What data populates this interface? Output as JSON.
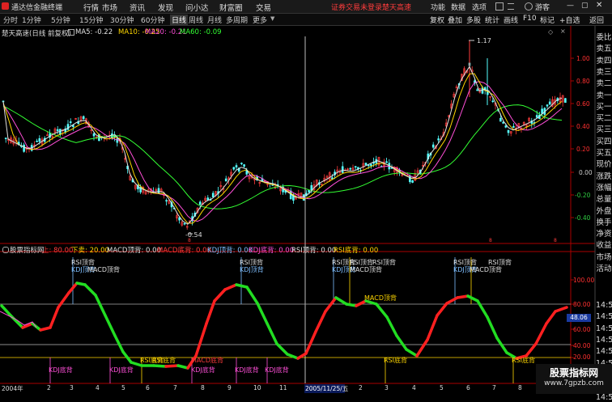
{
  "app": {
    "title": "通达信金融终端"
  },
  "menu": [
    "行情",
    "市场",
    "资讯",
    "发现",
    "问小达",
    "财富圈",
    "交易"
  ],
  "top_right": {
    "warning": "证券交易未登录",
    "brand": "楚天高速",
    "items": [
      "功能",
      "数据",
      "选项"
    ],
    "user": "游客"
  },
  "periods": [
    "分时",
    "1分钟",
    "5分钟",
    "15分钟",
    "30分钟",
    "60分钟",
    "日线",
    "周线",
    "月线",
    "多周期",
    "更多"
  ],
  "active_period": "日线",
  "toolbar": [
    "复权",
    "叠加",
    "多股",
    "统计",
    "画线",
    "F10",
    "标记",
    "+自选",
    "返回"
  ],
  "main_chart": {
    "title": "楚天高速(日线 前复权)",
    "ma": [
      {
        "label": "MA5: -0.22",
        "color": "#e0e0e0"
      },
      {
        "label": "MA10: -0.25",
        "color": "#ffd700"
      },
      {
        "label": "MA20: -0.21",
        "color": "#ff4fd8"
      },
      {
        "label": "MA60: -0.09",
        "color": "#33ff33"
      }
    ],
    "y_labels": [
      "1.00",
      "0.80",
      "0.60",
      "0.40",
      "0.20",
      "0.00",
      "-0.20",
      "-0.40"
    ],
    "annotations": {
      "high": "1.17",
      "low": "-0.54"
    }
  },
  "indicator": {
    "title": "股票指标网",
    "values": [
      {
        "label": "上: 80.00",
        "color": "#ff3c3c"
      },
      {
        "label": "下卖: 20.00",
        "color": "#ffd700"
      },
      {
        "label": "MACD顶背: 0.00",
        "color": "#e0e0e0"
      },
      {
        "label": "MACD底背: 0.00",
        "color": "#ff3c3c"
      },
      {
        "label": "KDJ顶背: 0.00",
        "color": "#7fbfff"
      },
      {
        "label": "KDJ底背: 0.00",
        "color": "#ff4fd8"
      },
      {
        "label": "RSI顶背: 0.00",
        "color": "#e0e0e0"
      },
      {
        "label": "RSI底背: 0.00",
        "color": "#ffd700"
      }
    ],
    "y_labels": [
      "100.00",
      "80.00",
      "60.00",
      "40.00",
      "20.00"
    ],
    "current_value": "48.06",
    "signals": {
      "rsi_top": "RSI顶背",
      "kdj_top": "KDJ顶背",
      "macd_top": "MACD顶背",
      "kdj_bottom": "KDJ底背",
      "rsi_bottom": "RSI底背",
      "macd_bottom": "MACD底背"
    }
  },
  "x_axis": {
    "year": "2004年",
    "labels": [
      "2",
      "3",
      "4",
      "5",
      "6",
      "7",
      "8",
      "9",
      "10",
      "11",
      "2",
      "3",
      "4",
      "5",
      "6",
      "7",
      "8"
    ],
    "cursor_date": "2005/11/25/五"
  },
  "side_panel": [
    "委比",
    "卖五",
    "卖四",
    "卖三",
    "卖二",
    "卖一",
    "买一",
    "买二",
    "买三",
    "买四",
    "买五",
    "现价",
    "涨跌",
    "涨幅",
    "总量",
    "外盘",
    "换手",
    "净资",
    "收益",
    "市场",
    "活动"
  ],
  "side_time_label": "14:5",
  "watermark": {
    "title": "股票指标网",
    "url": "www.7gpzb.com"
  }
}
